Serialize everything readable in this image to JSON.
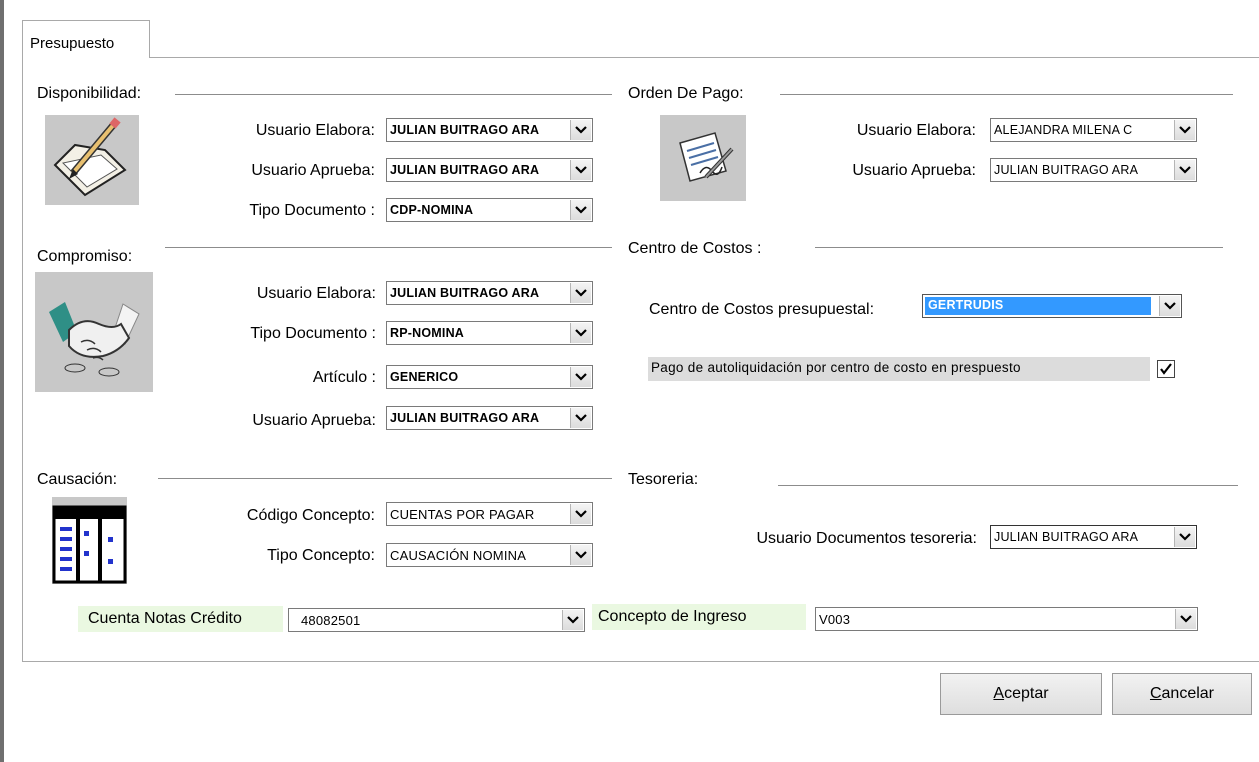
{
  "tab": {
    "label": "Presupuesto"
  },
  "disponibilidad": {
    "title": "Disponibilidad:",
    "usuario_elabora": {
      "label": "Usuario Elabora:",
      "value": "JULIAN BUITRAGO ARA"
    },
    "usuario_aprueba": {
      "label": "Usuario Aprueba:",
      "value": "JULIAN BUITRAGO ARA"
    },
    "tipo_documento": {
      "label": "Tipo Documento :",
      "value": "CDP-NOMINA"
    }
  },
  "orden_pago": {
    "title": "Orden De Pago:",
    "usuario_elabora": {
      "label": "Usuario Elabora:",
      "value": "ALEJANDRA MILENA C"
    },
    "usuario_aprueba": {
      "label": "Usuario Aprueba:",
      "value": "JULIAN BUITRAGO ARA"
    }
  },
  "compromiso": {
    "title": "Compromiso:",
    "usuario_elabora": {
      "label": "Usuario Elabora:",
      "value": "JULIAN BUITRAGO ARA"
    },
    "tipo_documento": {
      "label": "Tipo Documento :",
      "value": "RP-NOMINA"
    },
    "articulo": {
      "label": "Artículo :",
      "value": "GENERICO"
    },
    "usuario_aprueba": {
      "label": "Usuario Aprueba:",
      "value": "JULIAN BUITRAGO ARA"
    }
  },
  "centro_costos": {
    "title": "Centro de Costos :",
    "presupuestal": {
      "label": "Centro de Costos presupuestal:",
      "value": "GERTRUDIS"
    },
    "pago_autoliquidacion": {
      "label": "Pago de autoliquidación por centro de costo en prespuesto",
      "checked": true
    }
  },
  "causacion": {
    "title": "Causación:",
    "codigo_concepto": {
      "label": "Código Concepto:",
      "value": "CUENTAS POR PAGAR"
    },
    "tipo_concepto": {
      "label": "Tipo Concepto:",
      "value": "CAUSACIÓN NOMINA"
    }
  },
  "tesoreria": {
    "title": "Tesoreria:",
    "usuario_documentos": {
      "label": "Usuario Documentos tesoreria:",
      "value": "JULIAN BUITRAGO ARA"
    }
  },
  "cuenta_notas_credito": {
    "label": "Cuenta Notas Crédito",
    "value": "48082501"
  },
  "concepto_ingreso": {
    "label": "Concepto de Ingreso",
    "value": "V003"
  },
  "buttons": {
    "aceptar": {
      "key": "A",
      "rest": "ceptar"
    },
    "cancelar": {
      "key": "C",
      "rest": "ancelar"
    }
  },
  "colors": {
    "selection": "#3399ff",
    "green_label_bg": "#eaf8e1",
    "image_bg": "#c8c8c8"
  }
}
